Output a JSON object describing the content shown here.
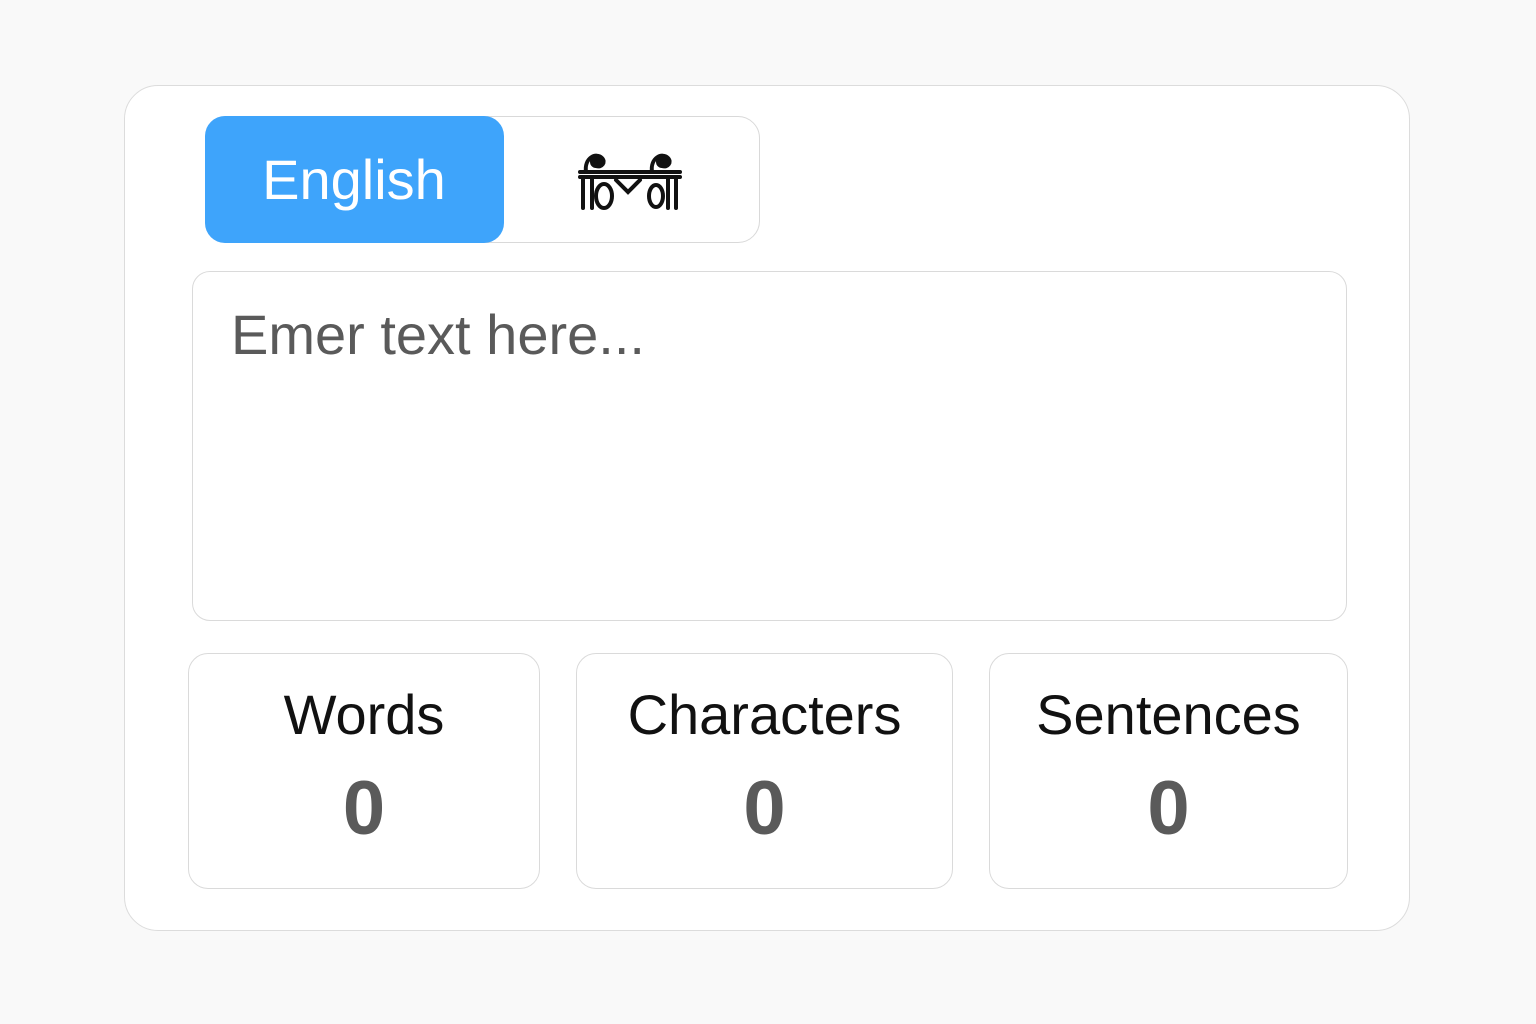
{
  "language_toggle": {
    "options": [
      {
        "label": "English",
        "active": true
      },
      {
        "label": "हिंदी",
        "active": false
      }
    ]
  },
  "editor": {
    "placeholder": "Emer text here..."
  },
  "stats": [
    {
      "label": "Words",
      "value": "0"
    },
    {
      "label": "Characters",
      "value": "0"
    },
    {
      "label": "Sentences",
      "value": "0"
    }
  ],
  "colors": {
    "accent": "#3ea4fb",
    "background": "#f9f9f9",
    "card": "#ffffff",
    "border": "#dadada",
    "value_text": "#5a5a5a"
  }
}
